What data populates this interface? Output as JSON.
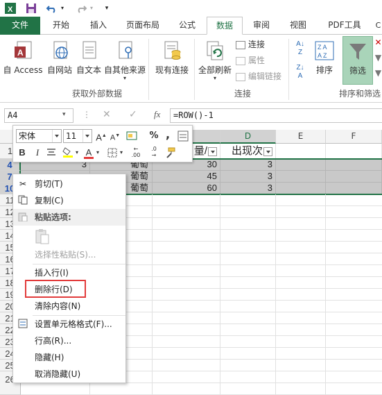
{
  "colors": {
    "brand": "#217346",
    "filter_active": "#a9d4b9",
    "highlight": "#e23a3a"
  },
  "qat": {
    "icons": [
      "excel-logo-icon",
      "save-icon",
      "undo-icon",
      "redo-icon",
      "customize-qat-icon"
    ]
  },
  "tabs": [
    {
      "label": "文件"
    },
    {
      "label": "开始"
    },
    {
      "label": "插入"
    },
    {
      "label": "页面布局"
    },
    {
      "label": "公式"
    },
    {
      "label": "数据"
    },
    {
      "label": "审阅"
    },
    {
      "label": "视图"
    },
    {
      "label": "PDF工具"
    }
  ],
  "ribbon": {
    "external": {
      "buttons": [
        "自 Access",
        "自网站",
        "自文本",
        "自其他来源",
        "现有连接"
      ],
      "group_label": "获取外部数据"
    },
    "connections": {
      "refresh_label": "全部刷新",
      "items": [
        "连接",
        "属性",
        "编辑链接"
      ],
      "group_label": "连接"
    },
    "sort_filter": {
      "sort_label": "排序",
      "filter_label": "筛选",
      "group_label": "排序和筛选"
    }
  },
  "formula_bar": {
    "name_box": "A4",
    "fx": "fx",
    "formula": "=ROW()-1",
    "cancel": "✕",
    "enter": "✓"
  },
  "grid": {
    "columns": [
      "D",
      "E",
      "F"
    ],
    "rows": [
      "1",
      "4",
      "7",
      "10",
      "11",
      "12",
      "13",
      "14",
      "15",
      "16",
      "17",
      "18",
      "19",
      "20",
      "21",
      "22",
      "23",
      "24",
      "25",
      "26"
    ],
    "header_row": {
      "col_c": "量/",
      "col_d": "出现次"
    },
    "data": [
      {
        "a": "3",
        "b": "葡萄",
        "c": "30",
        "d": "3"
      },
      {
        "a": "",
        "b": "葡萄",
        "c": "45",
        "d": "3"
      },
      {
        "a": "",
        "b": "葡萄",
        "c": "60",
        "d": "3"
      }
    ]
  },
  "mini_toolbar": {
    "font_name": "宋体",
    "font_size": "11",
    "grow_font": "A",
    "shrink_font": "A",
    "percent": "%",
    "comma": ",",
    "bold": "B",
    "italic": "I",
    "font_color": "A",
    "dec_increase": ".00",
    "dec_decrease": ".0"
  },
  "context_menu": {
    "cut": "剪切(T)",
    "copy": "复制(C)",
    "paste_options": "粘贴选项:",
    "paste_special": "选择性粘贴(S)...",
    "insert_row": "插入行(I)",
    "delete_row": "删除行(D)",
    "clear_contents": "清除内容(N)",
    "format_cells": "设置单元格格式(F)...",
    "row_height": "行高(R)...",
    "hide": "隐藏(H)",
    "unhide": "取消隐藏(U)"
  }
}
